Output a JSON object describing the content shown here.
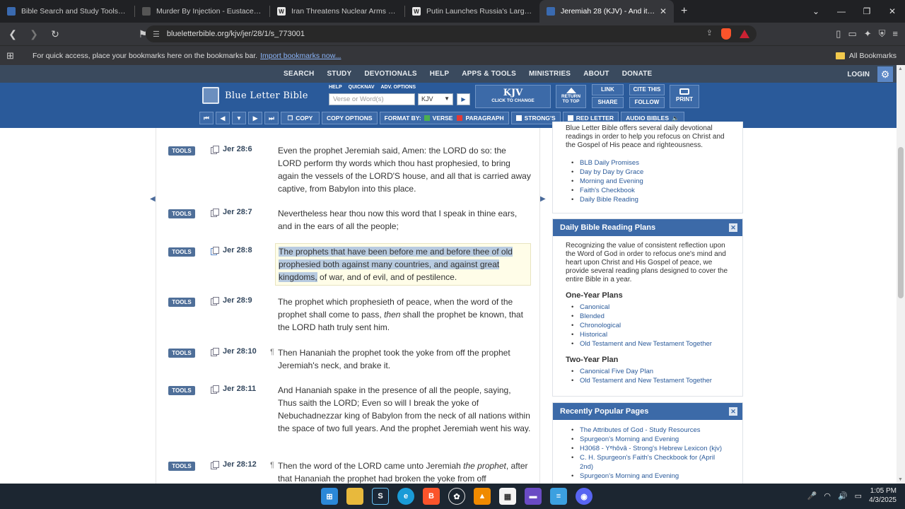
{
  "browser": {
    "tabs": [
      {
        "title": "Bible Search and Study Tools - Blue",
        "color": "#3a6ab0",
        "icon": "blb-icon"
      },
      {
        "title": "Murder By Injection - Eustace Mulli",
        "color": "#555555",
        "icon": "doc-icon"
      },
      {
        "title": "Iran Threatens Nuclear Arms Race a",
        "color": "#e8e8e8",
        "icon": "news-icon"
      },
      {
        "title": "Putin Launches Russia's Largest-Eve",
        "color": "#e8e8e8",
        "icon": "news-icon"
      },
      {
        "title": "Jeremiah 28 (KJV) - And it came",
        "color": "#3a6ab0",
        "icon": "blb-icon"
      }
    ],
    "url": "blueletterbible.org/kjv/jer/28/1/s_773001",
    "bookmarks_msg": "For quick access, place your bookmarks here on the bookmarks bar.",
    "import_link": "Import bookmarks now...",
    "all_bookmarks": "All Bookmarks"
  },
  "site": {
    "nav": [
      "SEARCH",
      "STUDY",
      "DEVOTIONALS",
      "HELP",
      "APPS & TOOLS",
      "MINISTRIES",
      "ABOUT",
      "DONATE"
    ],
    "login": "LOGIN",
    "logo": "Blue Letter Bible",
    "search_links": [
      "HELP",
      "QUICKNAV",
      "ADV. OPTIONS"
    ],
    "search_placeholder": "Verse or Word(s)",
    "version": "KJV",
    "version_box": {
      "label": "KJV",
      "sub": "CLICK TO CHANGE"
    },
    "return_top": [
      "RETURN",
      "TO TOP"
    ],
    "buttons": {
      "link": "LINK",
      "cite": "CITE THIS",
      "share": "SHARE",
      "follow": "FOLLOW",
      "print": "PRINT"
    },
    "subbar": {
      "copy": "COPY",
      "copy_options": "COPY OPTIONS",
      "format_by": "FORMAT BY:",
      "verse": "VERSE",
      "paragraph": "PARAGRAPH",
      "strongs": "STRONG'S",
      "red_letter": "RED LETTER",
      "audio": "AUDIO BIBLES"
    }
  },
  "verses": [
    {
      "tools": "TOOLS",
      "ref": "Jer 28:6",
      "pilcrow": "",
      "text": "Even the prophet Jeremiah said, Amen: the LORD do so: the LORD perform thy words which thou hast prophesied, to bring again the vessels of the LORD'S house, and all that is carried away captive, from Babylon into this place."
    },
    {
      "tools": "TOOLS",
      "ref": "Jer 28:7",
      "pilcrow": "",
      "text": "Nevertheless hear thou now this word that I speak in thine ears, and in the ears of all the people;"
    },
    {
      "tools": "TOOLS",
      "ref": "Jer 28:8",
      "pilcrow": "",
      "selected": "The prophets that have been before me and before thee of old prophesied both against many countries, and against great kingdoms,",
      "rest": " of war, and of evil, and of pestilence."
    },
    {
      "tools": "TOOLS",
      "ref": "Jer 28:9",
      "pilcrow": "",
      "text_a": "The prophet which prophesieth of peace, when the word of the prophet shall come to pass, ",
      "italic": "then",
      "text_b": " shall the prophet be known, that the LORD hath truly sent him."
    },
    {
      "tools": "TOOLS",
      "ref": "Jer 28:10",
      "pilcrow": "¶",
      "text": "Then Hananiah the prophet took the yoke from off the prophet Jeremiah's neck, and brake it."
    },
    {
      "tools": "TOOLS",
      "ref": "Jer 28:11",
      "pilcrow": "",
      "text": "And Hananiah spake in the presence of all the people, saying, Thus saith the LORD; Even so will I break the yoke of Nebuchadnezzar king of Babylon from the neck of all nations within the space of two full years. And the prophet Jeremiah went his way."
    },
    {
      "tools": "TOOLS",
      "ref": "Jer 28:12",
      "pilcrow": "¶",
      "text_a": "Then the word of the LORD came unto Jeremiah ",
      "italic": "the prophet",
      "text_b": ", after that Hananiah the prophet had broken the yoke from off"
    }
  ],
  "sidebar": {
    "devotional_intro": "Blue Letter Bible offers several daily devotional readings in order to help you refocus on Christ and the Gospel of His peace and righteousness.",
    "devotionals": [
      "BLB Daily Promises",
      "Day by Day by Grace",
      "Morning and Evening",
      "Faith's Checkbook",
      "Daily Bible Reading"
    ],
    "plans_title": "Daily Bible Reading Plans",
    "plans_intro": "Recognizing the value of consistent reflection upon the Word of God in order to refocus one's mind and heart upon Christ and His Gospel of peace, we provide several reading plans designed to cover the entire Bible in a year.",
    "one_year_title": "One-Year Plans",
    "one_year": [
      "Canonical",
      "Blended",
      "Chronological",
      "Historical",
      "Old Testament and New Testament Together"
    ],
    "two_year_title": "Two-Year Plan",
    "two_year": [
      "Canonical Five Day Plan",
      "Old Testament and New Testament Together"
    ],
    "popular_title": "Recently Popular Pages",
    "popular": [
      "The Attributes of God - Study Resources",
      "Spurgeon's Morning and Evening",
      "H3068 - Yᵉhôvâ - Strong's Hebrew Lexicon (kjv)",
      "C. H. Spurgeon's Faith's Checkbook for (April 2nd)",
      "Spurgeon's Morning and Evening"
    ]
  },
  "taskbar": {
    "time": "1:05 PM",
    "date": "4/3/2025"
  }
}
